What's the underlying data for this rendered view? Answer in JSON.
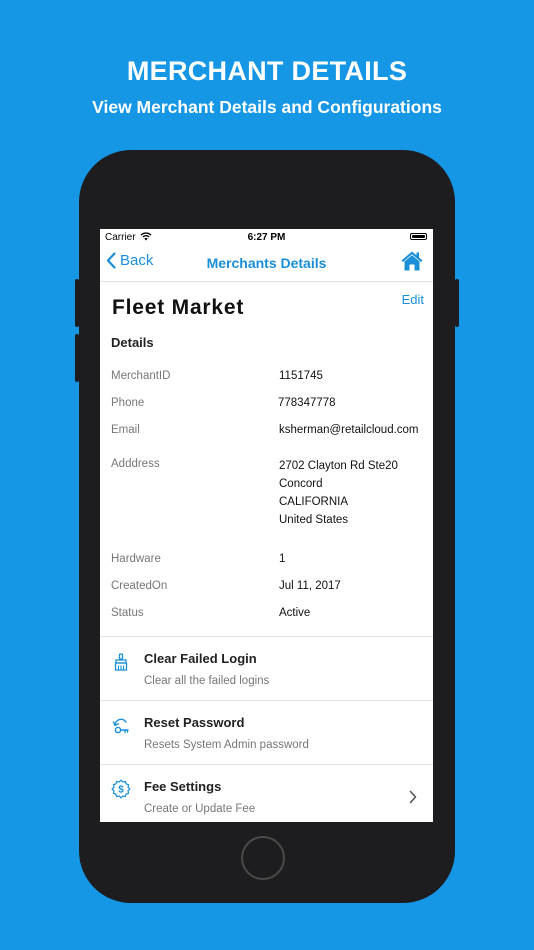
{
  "promo": {
    "title": "MERCHANT DETAILS",
    "subtitle": "View Merchant Details and Configurations"
  },
  "status_bar": {
    "carrier": "Carrier",
    "time": "6:27 PM"
  },
  "nav": {
    "back_label": "Back",
    "title": "Merchants Details"
  },
  "merchant": {
    "name": "Fleet Market",
    "edit_label": "Edit",
    "section_title": "Details"
  },
  "details": [
    {
      "label": "MerchantID",
      "value": "1151745"
    },
    {
      "label": "Phone",
      "value": "778347778"
    },
    {
      "label": "Email",
      "value": "ksherman@retailcloud.com"
    },
    {
      "label": "Adddress",
      "value": "2702 Clayton Rd Ste20\nConcord\nCALIFORNIA\nUnited States"
    },
    {
      "label": "Hardware",
      "value": "1"
    },
    {
      "label": "CreatedOn",
      "value": "Jul 11, 2017"
    },
    {
      "label": "Status",
      "value": "Active"
    }
  ],
  "actions": [
    {
      "title": "Clear Failed Login",
      "subtitle": "Clear all the failed logins",
      "icon": "broom-icon"
    },
    {
      "title": "Reset Password",
      "subtitle": "Resets System Admin password",
      "icon": "key-reset-icon"
    },
    {
      "title": "Fee Settings",
      "subtitle": "Create or Update Fee",
      "icon": "dollar-gear-icon"
    }
  ],
  "colors": {
    "background": "#1597e5",
    "accent": "#1a8fd8",
    "phone_body": "#1d1d1f"
  }
}
